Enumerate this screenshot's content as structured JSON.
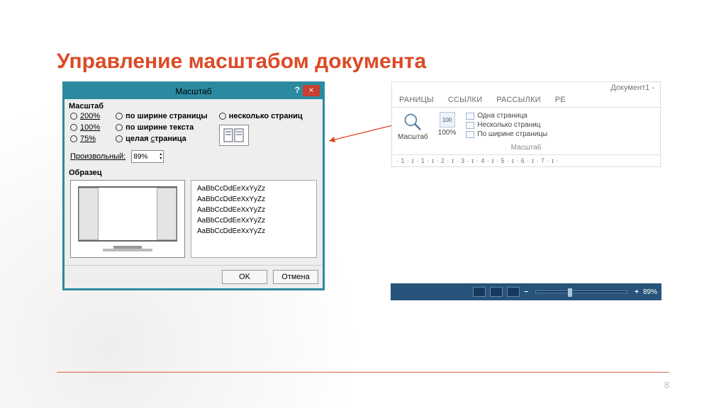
{
  "slide": {
    "title": "Управление масштабом документа",
    "page_number": "8"
  },
  "dialog": {
    "title": "Масштаб",
    "group_scale": "Масштаб",
    "group_sample": "Образец",
    "col1": {
      "r200": "200%",
      "r100": "100%",
      "r75": "75%"
    },
    "col2": {
      "page_width": "по ширине страницы",
      "text_width": "по ширине текста",
      "whole_page": "целая страница"
    },
    "col3": {
      "many_pages": "несколько страниц"
    },
    "arbitrary_label": "Произвольный:",
    "arbitrary_value": "89%",
    "sample_line": "AaBbCcDdEeXxYyZz",
    "ok": "OK",
    "cancel": "Отмена"
  },
  "ribbon": {
    "doc_title": "Документ1 -",
    "tabs": {
      "t1": "РАНИЦЫ",
      "t2": "ССЫЛКИ",
      "t3": "РАССЫЛКИ",
      "t4": "РЕ"
    },
    "btn_zoom": "Масштаб",
    "btn_100": "100%",
    "opt_one": "Одна страница",
    "opt_many": "Несколько страниц",
    "opt_width": "По ширине страницы",
    "group_label": "Масштаб",
    "ruler": "· 1 · ɪ · 1 · ɪ · 2 · ɪ · 3 · ɪ · 4 · ɪ · 5 · ɪ · 6 · ɪ · 7 · ɪ ·"
  },
  "statusbar": {
    "minus": "−",
    "plus": "+",
    "percent": "89%"
  }
}
